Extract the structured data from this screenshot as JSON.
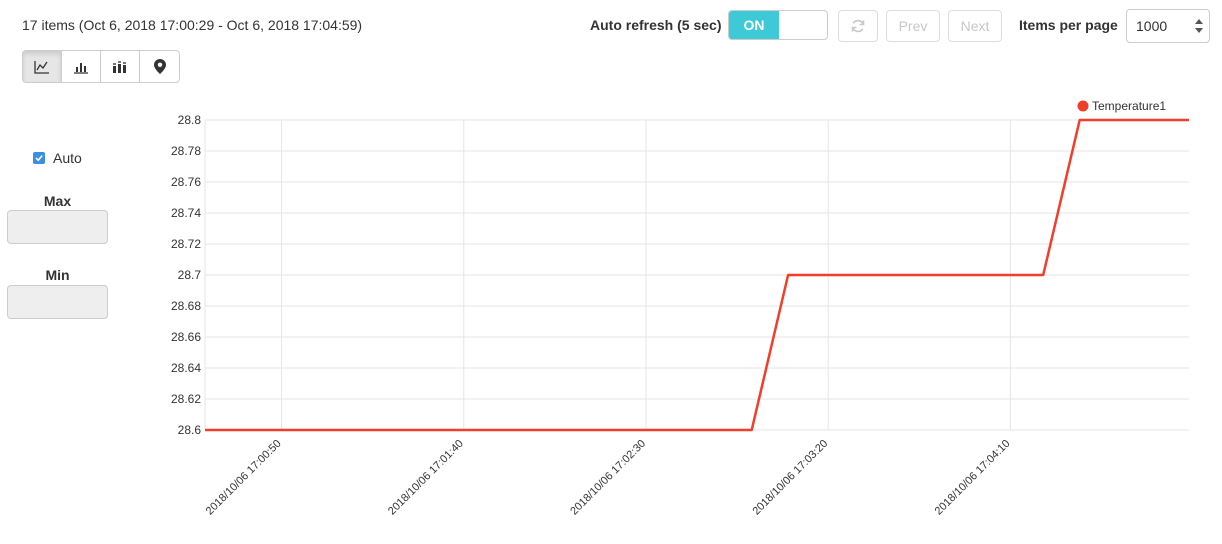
{
  "summary": "17 items (Oct 6, 2018 17:00:29 - Oct 6, 2018 17:04:59)",
  "toolbar": {
    "auto_refresh_label": "Auto refresh (5 sec)",
    "toggle_on_label": "ON",
    "prev_label": "Prev",
    "next_label": "Next",
    "items_per_page_label": "Items per page",
    "items_per_page_value": "1000"
  },
  "view_modes": [
    {
      "icon": "line-chart-icon",
      "active": true
    },
    {
      "icon": "bar-chart-icon",
      "active": false
    },
    {
      "icon": "stacked-bar-icon",
      "active": false
    },
    {
      "icon": "map-pin-icon",
      "active": false
    }
  ],
  "side_panel": {
    "auto_label": "Auto",
    "auto_checked": true,
    "max_label": "Max",
    "max_value": "",
    "min_label": "Min",
    "min_value": ""
  },
  "colors": {
    "accent": "#3ec9d6",
    "series": "#f03e2a",
    "grid": "#e6e6e6",
    "checkbox": "#3b8fe0"
  },
  "chart_data": {
    "type": "line",
    "ylim": [
      28.6,
      28.8
    ],
    "y_ticks": [
      "28.8",
      "28.78",
      "28.76",
      "28.74",
      "28.72",
      "28.7",
      "28.68",
      "28.66",
      "28.64",
      "28.62",
      "28.6"
    ],
    "xlim": [
      "2018/10/06 17:00:29",
      "2018/10/06 17:04:59"
    ],
    "x_ticks": [
      "2018/10/06 17:00:50",
      "2018/10/06 17:01:40",
      "2018/10/06 17:02:30",
      "2018/10/06 17:03:20",
      "2018/10/06 17:04:10"
    ],
    "grid": true,
    "legend_position": "top-right",
    "series": [
      {
        "name": "Temperature1",
        "color": "#f03e2a",
        "points": [
          [
            "2018/10/06 17:00:29",
            28.6
          ],
          [
            "2018/10/06 17:02:59",
            28.6
          ],
          [
            "2018/10/06 17:03:09",
            28.7
          ],
          [
            "2018/10/06 17:04:19",
            28.7
          ],
          [
            "2018/10/06 17:04:29",
            28.8
          ],
          [
            "2018/10/06 17:04:59",
            28.8
          ]
        ]
      }
    ]
  }
}
